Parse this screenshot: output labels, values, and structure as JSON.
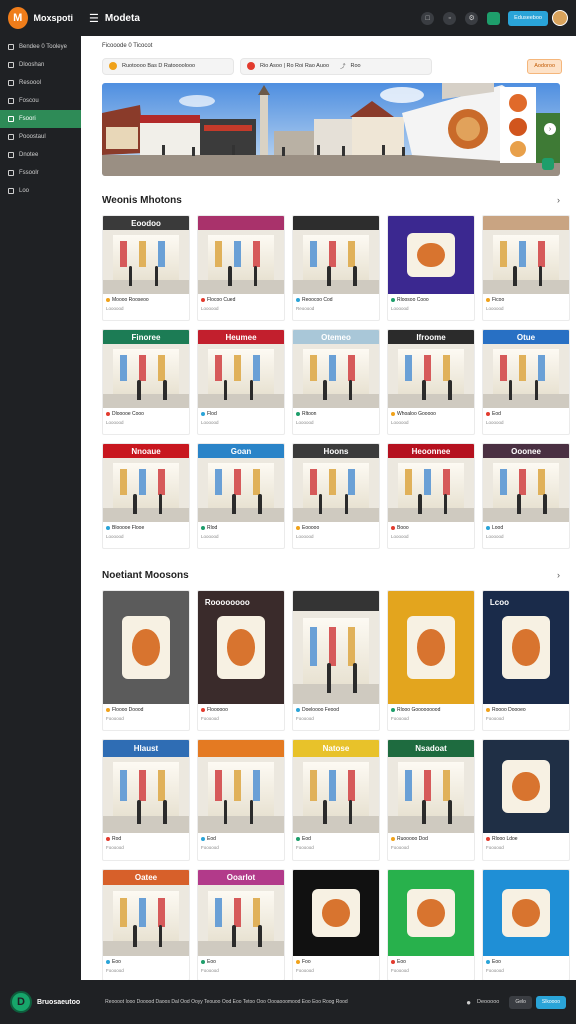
{
  "app": {
    "name": "Moxspoti",
    "title": "Modeta",
    "logo_glyph": "M"
  },
  "sidebar": {
    "items": [
      {
        "label": "Bendee 0 Tooleye",
        "active": false
      },
      {
        "label": "Dlooshan",
        "active": false
      },
      {
        "label": "Resoool",
        "active": false
      },
      {
        "label": "Foscou",
        "active": false
      },
      {
        "label": "Fsoori",
        "active": true
      },
      {
        "label": "Pooostaul",
        "active": false
      },
      {
        "label": "Dnotee",
        "active": false
      },
      {
        "label": "Fssoolr",
        "active": false
      },
      {
        "label": "Loo",
        "active": false
      }
    ]
  },
  "topbar": {
    "account_label": "Eduseeboo"
  },
  "breadcrumb": "Ficooode 0 Ticocot",
  "filters": {
    "first": "Ruotoooo Bas D Ratoooolooo",
    "second": "Rio Asoo | Ro Roi  Rao  Auoo",
    "second_tail": "Roo",
    "action": "Aodoroo"
  },
  "sections": [
    {
      "title": "Weonis Mhotons",
      "cards": [
        {
          "t1": "Moooo Rooseoo",
          "t2": "Loooood",
          "sign": "Eoodoo",
          "color": "#3a3a3a",
          "kind": "store"
        },
        {
          "t1": "Flocoo Cued",
          "t2": "Loooood",
          "sign": "",
          "color": "#a9326b",
          "kind": "store"
        },
        {
          "t1": "Reoocoo Cod",
          "t2": "Reooood",
          "sign": "",
          "color": "#2d2d2d",
          "kind": "mall"
        },
        {
          "t1": "Rloosoo Cooo",
          "t2": "Loooood",
          "sign": "",
          "color": "#3b2890",
          "kind": "food"
        },
        {
          "t1": "Ficoo",
          "t2": "Loooood",
          "sign": "",
          "color": "#c9a482",
          "kind": "mall"
        },
        {
          "t1": "Dlooooe Cooo",
          "t2": "Loooood",
          "sign": "Finoree",
          "color": "#1c7c55",
          "kind": "store"
        },
        {
          "t1": "Flod",
          "t2": "Loooood",
          "sign": "Heumee",
          "color": "#c21f2d",
          "kind": "store"
        },
        {
          "t1": "Rltoon",
          "t2": "Loooood",
          "sign": "Otemeo",
          "color": "#a9c7d8",
          "kind": "store"
        },
        {
          "t1": "Whoaloo Gooooo",
          "t2": "Loooood",
          "sign": "Ifroome",
          "color": "#2b2b2b",
          "kind": "store"
        },
        {
          "t1": "Eod",
          "t2": "Loooood",
          "sign": "Otue",
          "color": "#2870c4",
          "kind": "store"
        },
        {
          "t1": "Blooooe Flooe",
          "t2": "Loooood",
          "sign": "Nnoaue",
          "color": "#c8171f",
          "kind": "store"
        },
        {
          "t1": "Rlod",
          "t2": "Loooood",
          "sign": "Goan",
          "color": "#2a84c8",
          "kind": "store"
        },
        {
          "t1": "Eooooo",
          "t2": "Loooood",
          "sign": "Hoons",
          "color": "#3b3b3b",
          "kind": "store"
        },
        {
          "t1": "Booo",
          "t2": "Loooood",
          "sign": "Heoonnee",
          "color": "#b5111f",
          "kind": "store"
        },
        {
          "t1": "Lood",
          "t2": "Loooood",
          "sign": "Ooonee",
          "color": "#4a3042",
          "kind": "store"
        }
      ]
    },
    {
      "title": "Noetiant Moosons",
      "cards": [
        {
          "t1": "Floooo Doood",
          "t2": "Foooood",
          "sign": "",
          "color": "#5b5b5b",
          "kind": "food"
        },
        {
          "t1": "Floooooo",
          "t2": "Foooood",
          "sign": "Roooooooo",
          "color": "#3a2b2b",
          "kind": "food"
        },
        {
          "t1": "Doeloooo Feood",
          "t2": "Foooood",
          "sign": "",
          "color": "#343434",
          "kind": "mall"
        },
        {
          "t1": "Rlooo Gooooooood",
          "t2": "Foooood",
          "sign": "",
          "color": "#e3a51e",
          "kind": "food"
        },
        {
          "t1": "Roooo Doooeo",
          "t2": "Foooood",
          "sign": "Lcoo",
          "color": "#1a2b4a",
          "kind": "food"
        },
        {
          "t1": "Rod",
          "t2": "Foooood",
          "sign": "Hlaust",
          "color": "#2f6db4",
          "kind": "store"
        },
        {
          "t1": "Eod",
          "t2": "Foooood",
          "sign": "",
          "color": "#e47a22",
          "kind": "store"
        },
        {
          "t1": "Eod",
          "t2": "Foooood",
          "sign": "Natose",
          "color": "#e8c22a",
          "kind": "store"
        },
        {
          "t1": "Ruooooo Dod",
          "t2": "Foooood",
          "sign": "Nsadoat",
          "color": "#1e6b3f",
          "kind": "store"
        },
        {
          "t1": "Rlooo Ldoe",
          "t2": "Foooood",
          "sign": "",
          "color": "#1f2f45",
          "kind": "food"
        },
        {
          "t1": "Eoo",
          "t2": "Foooood",
          "sign": "Oatee",
          "color": "#d7602a",
          "kind": "store"
        },
        {
          "t1": "Eoo",
          "t2": "Foooood",
          "sign": "Ooarlot",
          "color": "#b23a8a",
          "kind": "store"
        },
        {
          "t1": "Foo",
          "t2": "Foooood",
          "sign": "",
          "color": "#111111",
          "kind": "food"
        },
        {
          "t1": "Eoo",
          "t2": "Foooood",
          "sign": "",
          "color": "#28b14c",
          "kind": "food"
        },
        {
          "t1": "Eoo",
          "t2": "Foooood",
          "sign": "",
          "color": "#1f8fd6",
          "kind": "food"
        }
      ]
    }
  ],
  "footer": {
    "brand": "Bruosaeutoo",
    "logo_glyph": "D",
    "text": "Reoooot Iooo Dooood Daoos Dal Ood Ooyy Teouoo Ood Eoo Tetoo Ooo Oooaooomood Eoo Eoo Roog Rood",
    "link": "Deooooo",
    "btn": "Gelo",
    "btn_primary": "Slkoooo"
  }
}
